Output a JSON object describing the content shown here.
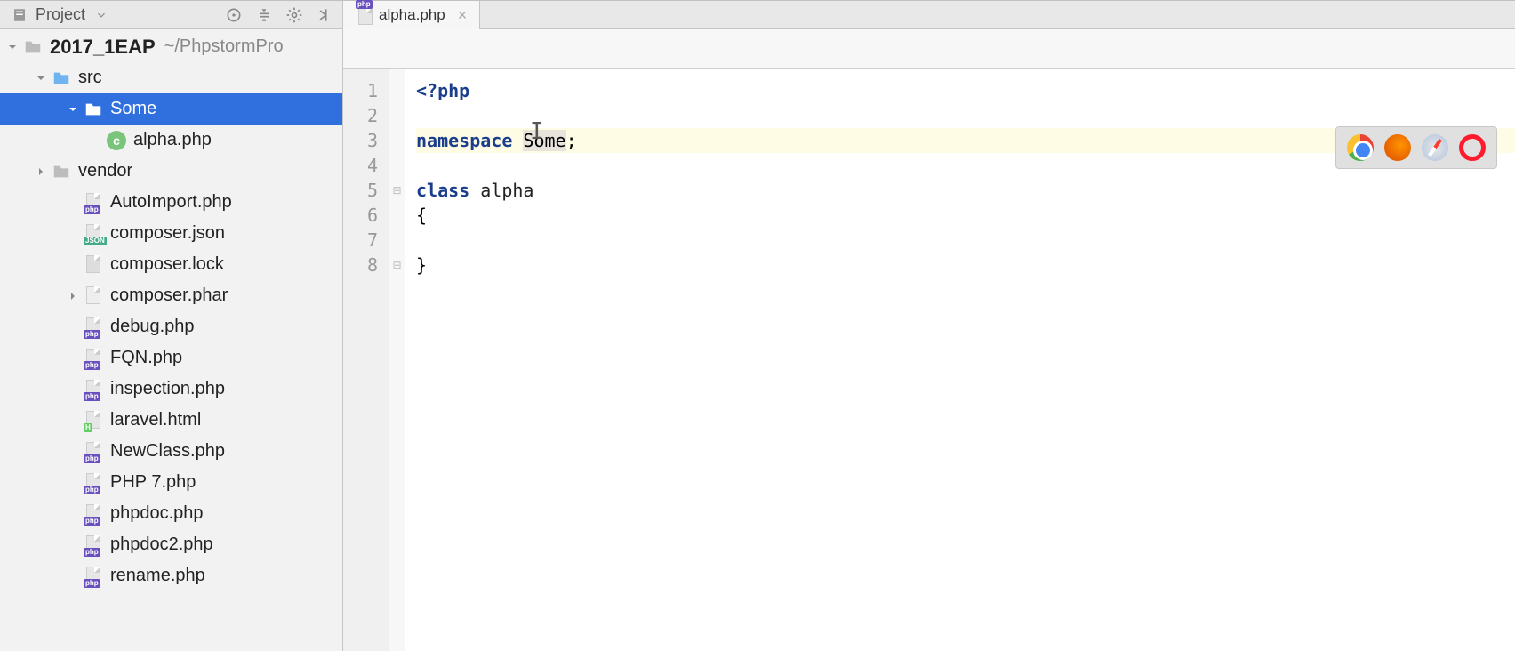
{
  "toolbar": {
    "project_label": "Project"
  },
  "project": {
    "root_name": "2017_1EAP",
    "root_path": "~/PhpstormPro",
    "src_folder": "src",
    "some_folder": "Some",
    "alpha_file": "alpha.php",
    "vendor_folder": "vendor",
    "files": [
      "AutoImport.php",
      "composer.json",
      "composer.lock",
      "composer.phar",
      "debug.php",
      "FQN.php",
      "inspection.php",
      "laravel.html",
      "NewClass.php",
      "PHP 7.php",
      "phpdoc.php",
      "phpdoc2.php",
      "rename.php"
    ]
  },
  "tab": {
    "filename": "alpha.php"
  },
  "code": {
    "open_tag": "<?php",
    "ns_kw": "namespace",
    "ns_name": "Some",
    "class_kw": "class",
    "class_name": "alpha",
    "lbrace": "{",
    "rbrace": "}",
    "semicolon": ";",
    "lines": [
      "1",
      "2",
      "3",
      "4",
      "5",
      "6",
      "7",
      "8"
    ]
  },
  "browsers": [
    "chrome",
    "firefox",
    "safari",
    "opera"
  ]
}
